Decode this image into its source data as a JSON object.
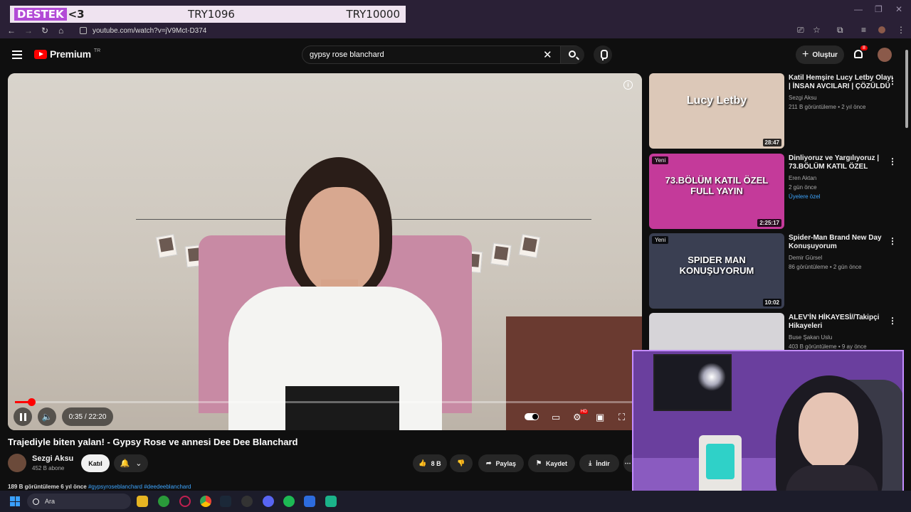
{
  "overlay": {
    "d1_badge": "DESTEK",
    "d1_text": "<3",
    "d2": "TRY1096",
    "d3": "TRY10000"
  },
  "browser": {
    "url": "youtube.com/watch?v=jV9Mct-D374",
    "controls": {
      "minimize": "—",
      "restore": "❐",
      "close": "✕"
    }
  },
  "header": {
    "logo": "Premium",
    "logo_country": "TR",
    "search_value": "gypsy rose blanchard",
    "create_label": "Oluştur",
    "notif_count": "8"
  },
  "player": {
    "time": "0:35 / 22:20",
    "progress_fraction": 0.026,
    "hd_badge": "HD"
  },
  "video": {
    "title": "Trajediyle biten yalan! - Gypsy Rose ve annesi Dee Dee Blanchard",
    "channel": "Sezgi Aksu",
    "subs": "452 B abone",
    "join": "Katıl",
    "likes": "8 B",
    "share": "Paylaş",
    "save": "Kaydet",
    "download": "İndir",
    "meta_views": "189 B görüntüleme  6 yıl önce",
    "meta_tags": "#gypsyroseblanchard #deedeeblanchard"
  },
  "recs": [
    {
      "title": "Katil Hemşire Lucy Letby Olayı | İNSAN AVCILARI | ÇÖZÜLDÜ",
      "channel": "Sezgi Aksu",
      "meta": "211 B görüntüleme • 2 yıl önce",
      "duration": "28:47",
      "thumb_text": "Lucy Letby",
      "thumb_bg": "#dcc8b8",
      "member": "",
      "new": ""
    },
    {
      "title": "Dinliyoruz ve Yargılıyoruz | 73.BÖLÜM KATIL ÖZEL",
      "channel": "Eren Aktan",
      "meta": "2 gün önce",
      "duration": "2:25:17",
      "thumb_text": "73.BÖLÜM KATIL ÖZEL FULL YAYIN",
      "thumb_bg": "#c43a9a",
      "member": "Üyelere özel",
      "new": "Yeni"
    },
    {
      "title": "Spider-Man Brand New Day Konuşuyorum",
      "channel": "Demir Gürsel",
      "meta": "86 görüntüleme • 2 gün önce",
      "duration": "10:02",
      "thumb_text": "SPIDER MAN KONUŞUYORUM",
      "thumb_bg": "#3a3f52",
      "member": "",
      "new": "Yeni"
    },
    {
      "title": "ALEV'İN HİKAYESİ//Takipçi Hikayeleri",
      "channel": "Buse Şakan Uslu",
      "meta": "403 B görüntüleme • 9 ay önce",
      "duration": "",
      "thumb_text": "",
      "thumb_bg": "#d6d4d8",
      "member": "",
      "new": ""
    }
  ],
  "taskbar": {
    "search": "Ara"
  }
}
